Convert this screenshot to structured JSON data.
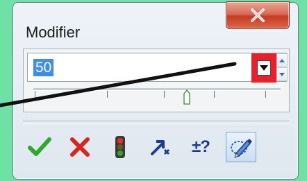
{
  "window": {
    "title": "Modifier",
    "close_icon": "close-x-icon"
  },
  "value_field": {
    "value": "50",
    "selected": true
  },
  "controls": {
    "dropdown_icon": "dropdown-arrow-icon",
    "spin_up_icon": "spin-up-icon",
    "spin_down_icon": "spin-down-icon"
  },
  "toolbar": {
    "tools": [
      {
        "name": "accept",
        "icon": "green-check-icon",
        "color": "#2ea82a"
      },
      {
        "name": "cancel",
        "icon": "red-x-icon",
        "color": "#d7261e"
      },
      {
        "name": "traffic-light",
        "icon": "traffic-light-icon"
      },
      {
        "name": "redirect",
        "icon": "blue-arrow-icon",
        "color": "#1a3c96"
      },
      {
        "name": "tolerance",
        "icon": "plus-minus-question-icon",
        "label": "±?"
      },
      {
        "name": "pen-tool",
        "icon": "pen-lasso-icon"
      }
    ]
  },
  "colors": {
    "background": "#6fe0a6",
    "highlight": "#e9202b",
    "selection": "#3d8ee4"
  }
}
